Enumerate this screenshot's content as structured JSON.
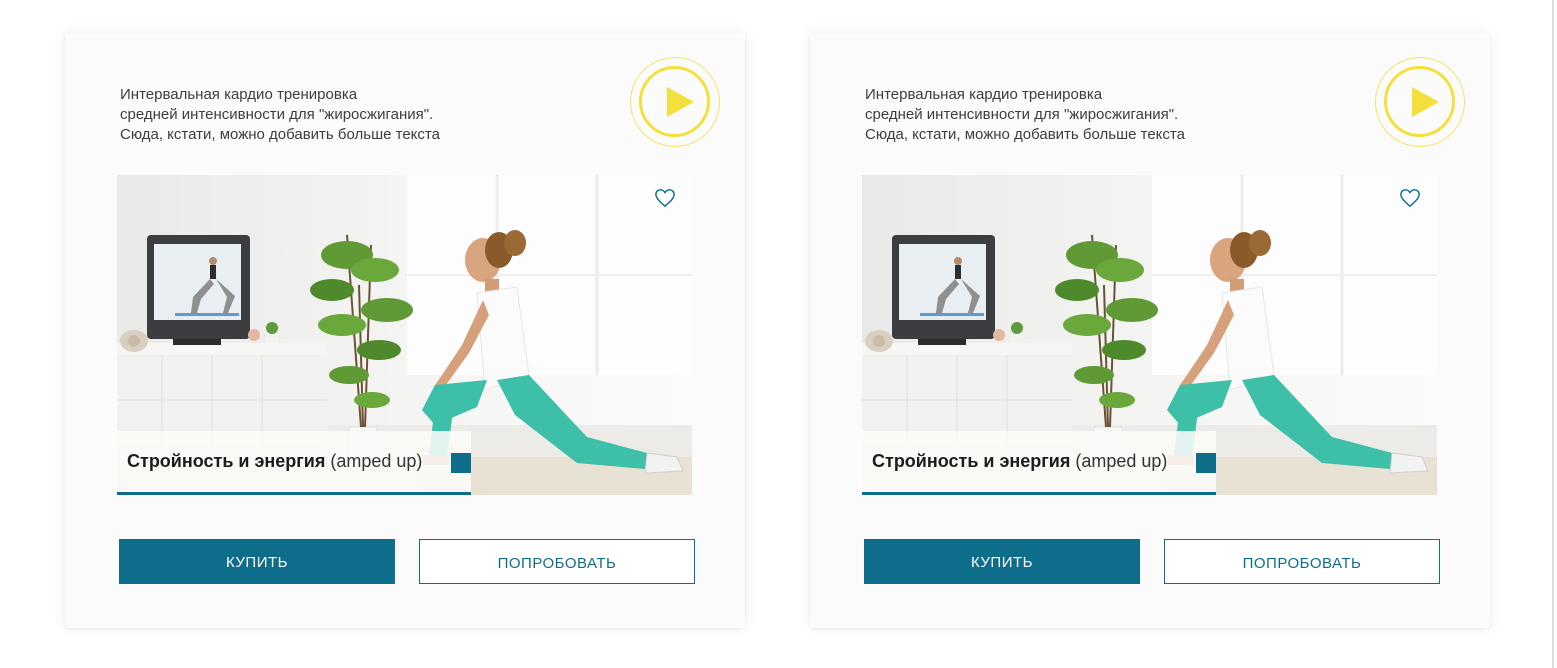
{
  "cards": [
    {
      "description": [
        "Интервальная кардио тренировка",
        "средней интенсивности для \"жиросжигания\".",
        "Сюда, кстати, можно добавить больше текста"
      ],
      "title": "Стройность и энергия",
      "subtitle": "(amped up)",
      "progress": 0.62,
      "buy_label": "КУПИТЬ",
      "try_label": "ПОПРОБОВАТЬ",
      "icons": {
        "play": "play-icon",
        "favorite": "heart-icon"
      }
    },
    {
      "description": [
        "Интервальная кардио тренировка",
        "средней интенсивности для \"жиросжигания\".",
        "Сюда, кстати, можно добавить больше текста"
      ],
      "title": "Стройность и энергия",
      "subtitle": "(amped up)",
      "progress": 0.62,
      "buy_label": "КУПИТЬ",
      "try_label": "ПОПРОБОВАТЬ",
      "icons": {
        "play": "play-icon",
        "favorite": "heart-icon"
      }
    }
  ],
  "colors": {
    "accent": "#0f6d8c",
    "play": "#f4e03c",
    "pants": "#3dbfa8"
  }
}
